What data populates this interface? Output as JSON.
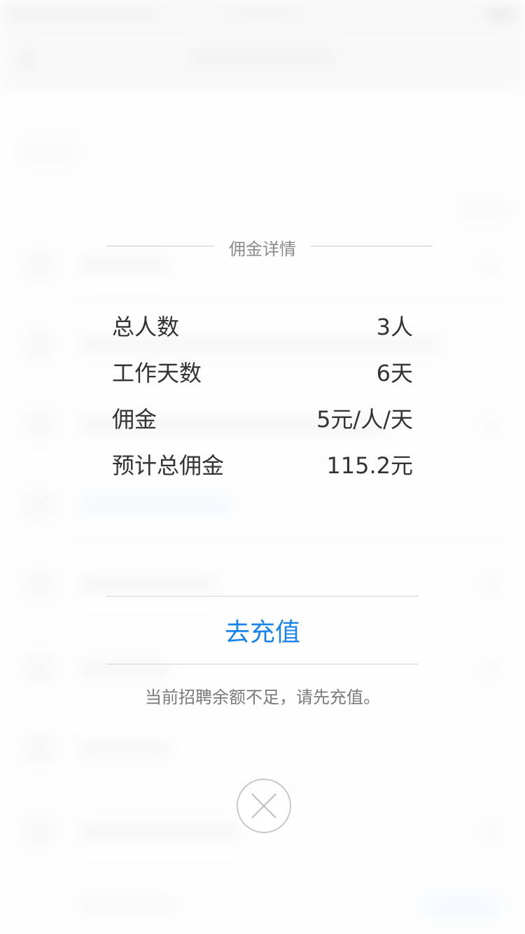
{
  "dialog": {
    "title": "佣金详情",
    "details": [
      {
        "label": "总人数",
        "value": "3人"
      },
      {
        "label": "工作天数",
        "value": "6天"
      },
      {
        "label": "佣金",
        "value": "5元/人/天"
      },
      {
        "label": "预计总佣金",
        "value": "115.2元"
      }
    ],
    "recharge_label": "去充值",
    "notice": "当前招聘余额不足，请先充值。",
    "close_icon": "close-icon"
  },
  "colors": {
    "accent": "#1a84ee",
    "text_primary": "#333333",
    "text_secondary": "#8a8a8a"
  }
}
